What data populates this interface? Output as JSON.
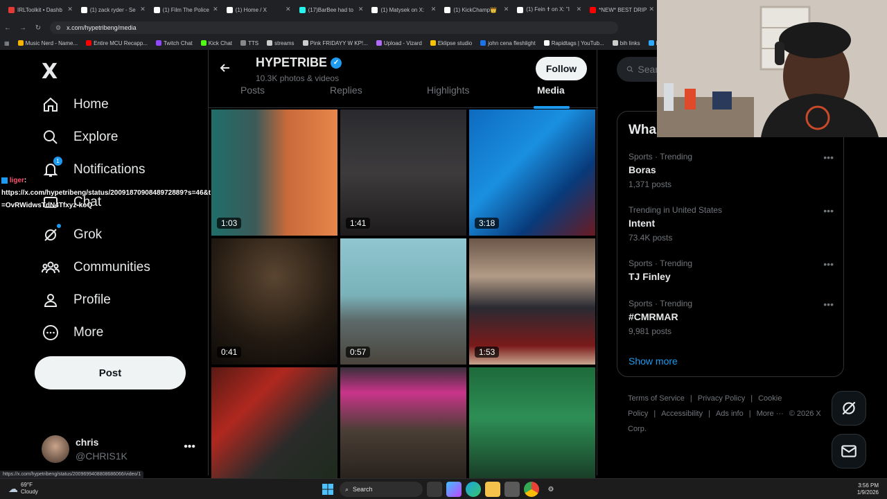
{
  "browser": {
    "tabs": [
      {
        "label": "IRLToolkit • Dashb",
        "color": "#e53935"
      },
      {
        "label": "(1) zack ryder - Se",
        "color": "#ffffff"
      },
      {
        "label": "(1) Film The Police",
        "color": "#ffffff"
      },
      {
        "label": "(1) Home / X",
        "color": "#ffffff"
      },
      {
        "label": "(17)BarBee had to",
        "color": "#25f4ee"
      },
      {
        "label": "(1) Matysek on X:",
        "color": "#ffffff"
      },
      {
        "label": "(1) KickChamp👑",
        "color": "#ffffff"
      },
      {
        "label": "(1) Fein 🕇 on X: \"I",
        "color": "#ffffff"
      },
      {
        "label": "*NEW* BEST DRIP",
        "color": "#ff0000"
      }
    ],
    "url": "x.com/hypetribeng/media",
    "bookmarks": [
      {
        "label": "Music Nerd - Name...",
        "color": "#f4b400"
      },
      {
        "label": "Entire MCU Recapp...",
        "color": "#ff0000"
      },
      {
        "label": "Twitch Chat",
        "color": "#9146ff"
      },
      {
        "label": "Kick Chat",
        "color": "#53fc18"
      },
      {
        "label": "TTS",
        "color": "#888888"
      },
      {
        "label": "streams",
        "color": "#cccccc"
      },
      {
        "label": "Pink FRIDAYY W KP!...",
        "color": "#cccccc"
      },
      {
        "label": "Upload - Vizard",
        "color": "#b36bff"
      },
      {
        "label": "Eklipse studio",
        "color": "#f9c300"
      },
      {
        "label": "john cena fleshlight",
        "color": "#1a73e8"
      },
      {
        "label": "Rapidtags | YouTub...",
        "color": "#ffffff"
      },
      {
        "label": "bih links",
        "color": "#cccccc"
      },
      {
        "label": "Photop",
        "color": "#31a8ff"
      }
    ],
    "status_url": "https://x.com/hypetribeng/status/2009699408808686066/video/1"
  },
  "nav": {
    "logo": "X",
    "items": [
      {
        "label": "Home",
        "icon": "home-icon"
      },
      {
        "label": "Explore",
        "icon": "search-icon"
      },
      {
        "label": "Notifications",
        "icon": "bell-icon",
        "badge": "1"
      },
      {
        "label": "Chat",
        "icon": "chat-icon"
      },
      {
        "label": "Grok",
        "icon": "grok-icon"
      },
      {
        "label": "Communities",
        "icon": "communities-icon"
      },
      {
        "label": "Profile",
        "icon": "profile-icon"
      },
      {
        "label": "More",
        "icon": "more-circle-icon"
      }
    ],
    "post_label": "Post",
    "account": {
      "name": "chris",
      "handle": "@CHRIS1K",
      "more": "•••"
    }
  },
  "chat_overlay": {
    "user": "liger",
    "sep": ":",
    "message": "https://x.com/hypetribeng/status/2009187090848972889?s=46&t=OvRWidwsTdN4Tfxyz-koQ"
  },
  "profile": {
    "name": "HYPETRIBE",
    "count": "10.3K photos & videos",
    "follow_label": "Follow",
    "tabs": [
      "Posts",
      "Replies",
      "Highlights",
      "Media"
    ],
    "active_tab": "Media"
  },
  "media": [
    {
      "duration": "1:03",
      "bg": "linear-gradient(90deg,#1f6e6a 0%,#3c5a58 35%,#c86a3a 60%,#e7864b 100%)"
    },
    {
      "duration": "1:41",
      "bg": "linear-gradient(180deg,#2a2a2e 0%,#3d3b3c 50%,#1e1b1c 100%)"
    },
    {
      "duration": "3:18",
      "bg": "linear-gradient(135deg,#0e6bbf 0%,#1a8fe0 40%,#083a7a 70%,#6b1a20 100%)"
    },
    {
      "duration": "0:41",
      "bg": "radial-gradient(circle at 50% 30%,#5a4530 0%,#231a12 60%,#0d0a08 100%)"
    },
    {
      "duration": "0:57",
      "bg": "linear-gradient(180deg,#8fc6cf 0%,#7ab2ba 45%,#5d6a6a 65%,#4a443c 100%)"
    },
    {
      "duration": "1:53",
      "bg": "linear-gradient(180deg,#6b5648 0%,#b29b86 30%,#2a2a32 55%,#7a1a1a 85%,#c9a58e 100%)"
    },
    {
      "duration": "",
      "bg": "linear-gradient(135deg,#5a1a14 0%,#b0281f 30%,#2a2b2a 60%,#1c2b1a 100%)"
    },
    {
      "duration": "",
      "bg": "linear-gradient(180deg,#3a2f3a 0%,#c9348a 20%,#4a3e35 50%,#1e1a16 100%)"
    },
    {
      "duration": "",
      "bg": "linear-gradient(180deg,#1e6a3a 0%,#2d8f55 40%,#142a1c 100%)"
    }
  ],
  "sidebar": {
    "search_placeholder": "Sear",
    "trends_title": "Wha",
    "trends": [
      {
        "context": "Sports · Trending",
        "name": "Boras",
        "posts": "1,371 posts"
      },
      {
        "context": "Trending in United States",
        "name": "Intent",
        "posts": "73.4K posts"
      },
      {
        "context": "Sports · Trending",
        "name": "TJ Finley",
        "posts": ""
      },
      {
        "context": "Sports · Trending",
        "name": "#CMRMAR",
        "posts": "9,981 posts"
      }
    ],
    "trend_more": "•••",
    "show_more": "Show more",
    "footer": [
      "Terms of Service",
      "|",
      "Privacy Policy",
      "|",
      "Cookie Policy",
      "|",
      "Accessibility",
      "|",
      "Ads info",
      "|",
      "More ···",
      "© 2026 X Corp."
    ]
  },
  "taskbar": {
    "weather_temp": "69°F",
    "weather_desc": "Cloudy",
    "search_label": "Search",
    "time": "3:56 PM",
    "date": "1/9/2026"
  }
}
